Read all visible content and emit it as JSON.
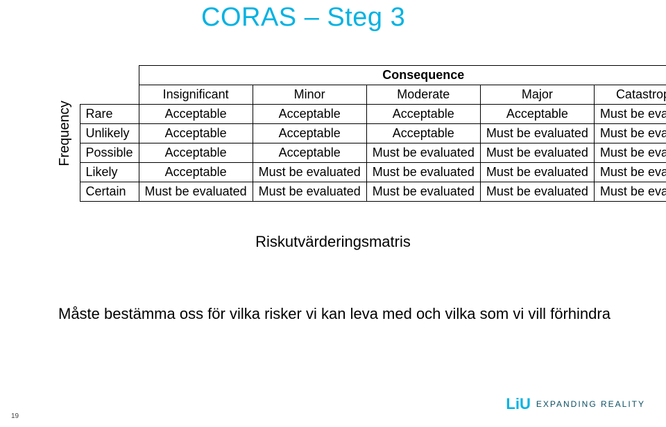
{
  "title": "CORAS – Steg 3",
  "matrix": {
    "axis_y_label": "Frequency",
    "consequence_header": "Consequence",
    "col_headers": [
      "Insignificant",
      "Minor",
      "Moderate",
      "Major",
      "Catastrophic"
    ],
    "rows": [
      {
        "label": "Rare",
        "cells": [
          "Acceptable",
          "Acceptable",
          "Acceptable",
          "Acceptable",
          "Must be evaluated"
        ]
      },
      {
        "label": "Unlikely",
        "cells": [
          "Acceptable",
          "Acceptable",
          "Acceptable",
          "Must be evaluated",
          "Must be evaluated"
        ]
      },
      {
        "label": "Possible",
        "cells": [
          "Acceptable",
          "Acceptable",
          "Must be evaluated",
          "Must be evaluated",
          "Must be evaluated"
        ]
      },
      {
        "label": "Likely",
        "cells": [
          "Acceptable",
          "Must be evaluated",
          "Must be evaluated",
          "Must be evaluated",
          "Must be evaluated"
        ]
      },
      {
        "label": "Certain",
        "cells": [
          "Must be evaluated",
          "Must be evaluated",
          "Must be evaluated",
          "Must be evaluated",
          "Must be evaluated"
        ]
      }
    ]
  },
  "caption": "Riskutvärderingsmatris",
  "subtext": "Måste bestämma oss för vilka risker vi kan leva med och vilka som vi vill förhindra",
  "page_number": "19",
  "logo": {
    "brand": "LiU",
    "tagline": "EXPANDING REALITY"
  },
  "colors": {
    "accent": "#04b2e2"
  }
}
